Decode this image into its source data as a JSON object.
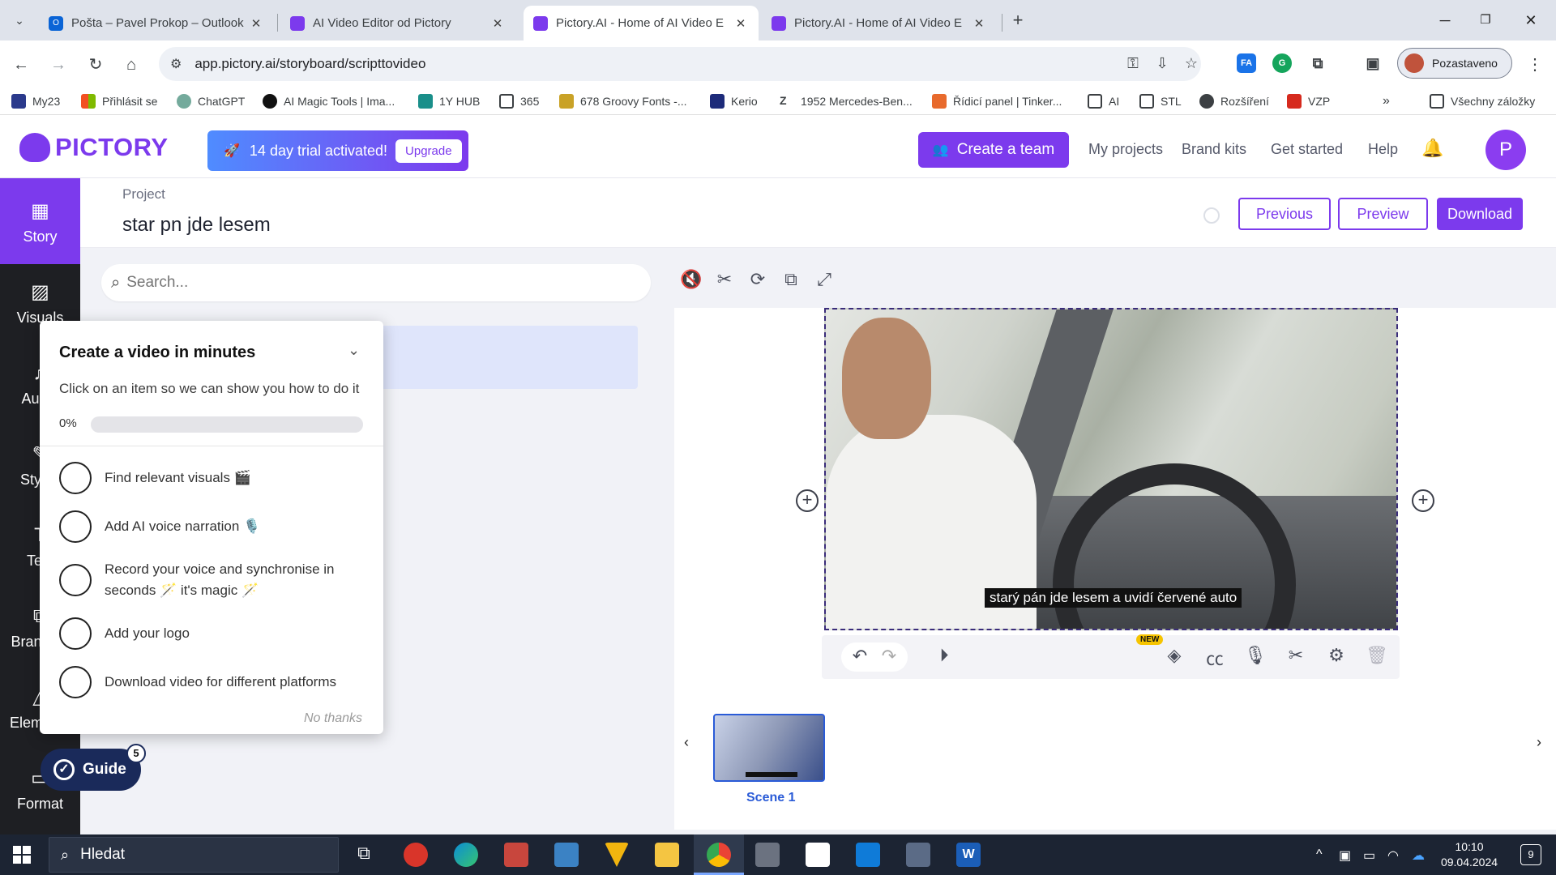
{
  "browser": {
    "tabs": [
      {
        "title": "Pošta – Pavel Prokop – Outlook",
        "favicon_color": "#0a64d6"
      },
      {
        "title": "AI Video Editor od Pictory",
        "favicon_color": "#7c3aed"
      },
      {
        "title": "Pictory.AI - Home of AI Video E",
        "favicon_color": "#7c3aed"
      },
      {
        "title": "Pictory.AI - Home of AI Video E",
        "favicon_color": "#7c3aed"
      }
    ],
    "url": "app.pictory.ai/storyboard/scripttovideo",
    "profile_label": "Pozastaveno",
    "extensions": [
      "FA"
    ],
    "bookmarks": [
      {
        "label": "My23",
        "icon_color": "#2b3a8c"
      },
      {
        "label": "Přihlásit se",
        "icon_color": "#f25022"
      },
      {
        "label": "ChatGPT",
        "icon_color": "#74aa9c"
      },
      {
        "label": "AI Magic Tools | Ima...",
        "icon_color": "#111111"
      },
      {
        "label": "1Y HUB",
        "icon_color": "#1a8f8a"
      },
      {
        "label": "365",
        "icon_color": "folder"
      },
      {
        "label": "678 Groovy Fonts -...",
        "icon_color": "#c9a227"
      },
      {
        "label": "Kerio",
        "icon_color": "#1d2b7a"
      },
      {
        "label": "1952 Mercedes-Ben...",
        "icon_color": "#000000"
      },
      {
        "label": "Řídicí panel | Tinker...",
        "icon_color": "#e86a2c"
      },
      {
        "label": "AI",
        "icon_color": "folder"
      },
      {
        "label": "STL",
        "icon_color": "folder"
      },
      {
        "label": "Rozšíření",
        "icon_color": "puzzle"
      },
      {
        "label": "VZP",
        "icon_color": "#d62a1e"
      }
    ],
    "bookmarks_more": "»",
    "all_bookmarks_label": "Všechny záložky"
  },
  "app": {
    "logo_text": "PICTORY",
    "trial_text": "14 day trial activated!",
    "upgrade_label": "Upgrade",
    "create_team_label": "Create a team",
    "nav": [
      "My projects",
      "Brand kits",
      "Get started",
      "Help"
    ],
    "user_initial": "P",
    "accent_color": "#7c3aed"
  },
  "rail": {
    "items": [
      {
        "label": "Story",
        "icon": "grid-icon",
        "active": true
      },
      {
        "label": "Visuals",
        "icon": "image-icon",
        "active": false
      },
      {
        "label": "Audio",
        "icon": "music-icon",
        "active": false
      },
      {
        "label": "Styles",
        "icon": "brush-icon",
        "active": false
      },
      {
        "label": "Text",
        "icon": "text-icon",
        "active": false
      },
      {
        "label": "Branding",
        "icon": "copy-icon",
        "active": false
      },
      {
        "label": "Elements",
        "icon": "shapes-icon",
        "active": false
      },
      {
        "label": "Format",
        "icon": "format-icon",
        "active": false
      }
    ]
  },
  "project": {
    "label": "Project",
    "name": "star pn jde lesem",
    "previous_label": "Previous",
    "preview_label": "Preview",
    "download_label": "Download"
  },
  "script": {
    "search_placeholder": "Search..."
  },
  "guide": {
    "title": "Create a video in minutes",
    "subtitle": "Click on an item so we can show you how to do it",
    "progress_label": "0%",
    "progress": 0,
    "items": [
      "Find relevant visuals 🎬",
      "Add AI voice narration 🎙️",
      "Record your voice and synchronise in seconds 🪄 it's magic 🪄",
      "Add your logo",
      "Download video for different platforms"
    ],
    "no_thanks_label": "No thanks",
    "button_label": "Guide",
    "badge_count": "5"
  },
  "editor": {
    "toolbar_icons": [
      "mute-icon",
      "scissors-icon",
      "loop-icon",
      "duplicate-icon",
      "fullscreen-icon"
    ],
    "subtitle_text": "starý pán jde lesem a uvidí červené auto",
    "controls_new_badge": "NEW",
    "scene_label": "Scene 1"
  },
  "taskbar": {
    "search_label": "Hledat",
    "time": "10:10",
    "date": "09.04.2024",
    "notifications": "9"
  }
}
